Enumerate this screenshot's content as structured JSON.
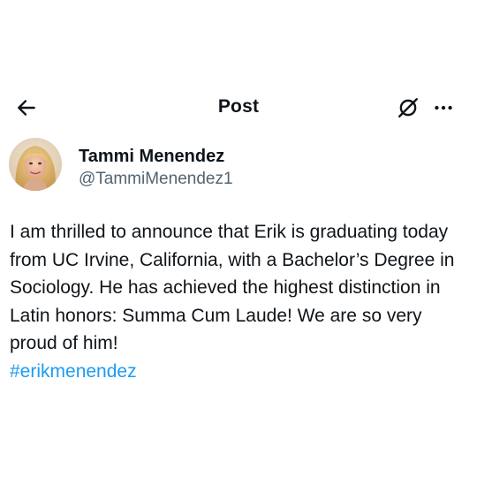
{
  "header": {
    "title": "Post",
    "back_icon": "arrow-left-icon",
    "grok_icon": "grok-icon",
    "more_icon": "more-horizontal-icon"
  },
  "author": {
    "display_name": "Tammi Menendez",
    "handle": "@TammiMenendez1",
    "avatar_icon": "profile-avatar"
  },
  "post": {
    "text": "I am thrilled to announce that Erik is graduating today from UC Irvine, California, with a Bachelor’s Degree in Sociology. He has achieved the highest distinction in Latin honors: Summa Cum Laude! We are so very proud of him!",
    "hashtag": "#erikmenendez"
  },
  "colors": {
    "text": "#0f1419",
    "secondary_text": "#536471",
    "link": "#1d9bf0",
    "background": "#ffffff"
  }
}
